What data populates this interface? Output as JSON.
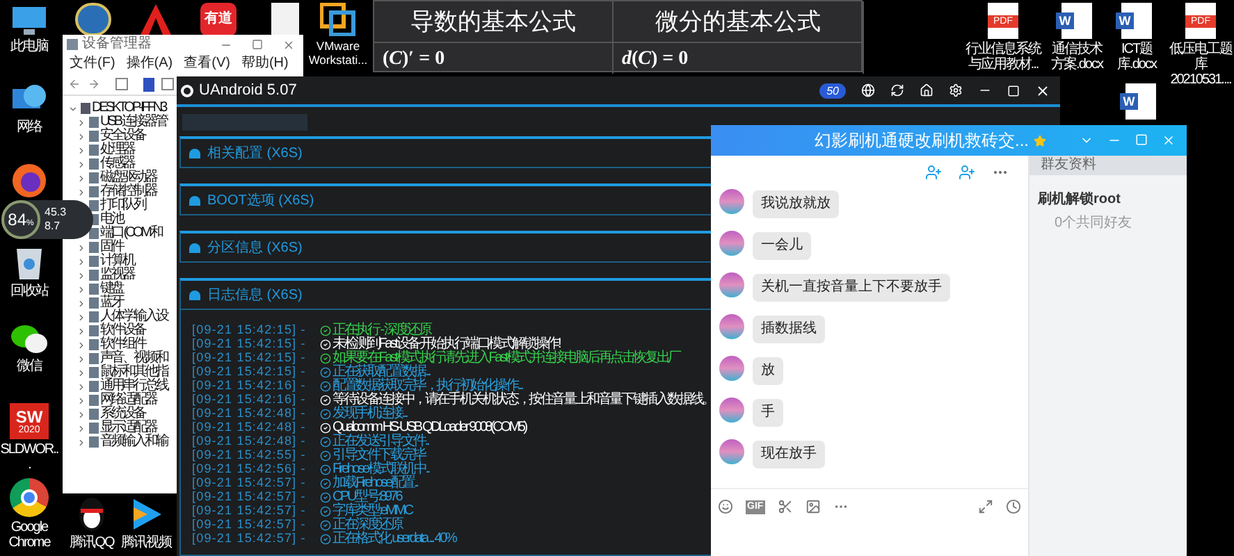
{
  "desktop_left": [
    {
      "kind": "computer",
      "label": "此电脑"
    },
    {
      "kind": "network",
      "label": "网络"
    },
    {
      "kind": "firefox"
    },
    {
      "kind": "recycle",
      "label": "回收站"
    },
    {
      "kind": "wechat",
      "label": "微信"
    },
    {
      "kind": "solidworks",
      "label": "SLDWOR...",
      "logo": "SW",
      "logo_sub": "2020"
    },
    {
      "kind": "chrome",
      "label": "Google Chrome"
    }
  ],
  "net_widget": {
    "percent": "84",
    "unit": "%",
    "upload": "45.3",
    "download": "8.7"
  },
  "desktop_top": [
    {
      "kind": "badge"
    },
    {
      "kind": "acrobat"
    },
    {
      "kind": "youdao",
      "logo": "有道"
    },
    {
      "kind": "file"
    },
    {
      "kind": "vmware",
      "label": "VMware Workstati..."
    }
  ],
  "desktop_bottom": [
    {
      "kind": "qq",
      "label": "腾讯QQ"
    },
    {
      "kind": "video",
      "label": "腾讯视频"
    }
  ],
  "desktop_right": [
    {
      "kind": "pdf",
      "logo": "PDF",
      "label": "行业信息系统与应用教材..."
    },
    {
      "kind": "word",
      "logo": "W",
      "label": "通信技术方案.docx"
    },
    {
      "kind": "word",
      "logo": "W",
      "label": "ICT题库.docx"
    },
    {
      "kind": "pdf",
      "logo": "PDF",
      "label": "低压电工题库20210531...."
    },
    {
      "kind": "word",
      "logo": "W"
    }
  ],
  "formula_slide": {
    "headers": [
      "导数的基本公式",
      "微分的基本公式"
    ],
    "formulas": [
      "(*C*)′ = 0",
      "*d*(*C*) = 0"
    ]
  },
  "device_manager": {
    "title": "设备管理器",
    "menu": [
      "文件(F)",
      "操作(A)",
      "查看(V)",
      "帮助(H)"
    ],
    "tree": [
      {
        "label": "DESKTOP-IFFN3",
        "expanded": true,
        "children": [
          {
            "label": "USB 连接器管",
            "expanded": false
          },
          {
            "label": "安全设备",
            "expanded": false
          },
          {
            "label": "处理器",
            "expanded": false
          },
          {
            "label": "传感器",
            "expanded": false
          },
          {
            "label": "磁盘驱动器",
            "expanded": false
          },
          {
            "label": "存储控制器",
            "expanded": false
          },
          {
            "label": "打印队列",
            "expanded": false
          },
          {
            "label": "电池",
            "expanded": false
          },
          {
            "label": "端口 (COM 和",
            "expanded": false
          },
          {
            "label": "固件",
            "expanded": false
          },
          {
            "label": "计算机",
            "expanded": false
          },
          {
            "label": "监视器",
            "expanded": false
          },
          {
            "label": "键盘",
            "expanded": false
          },
          {
            "label": "蓝牙",
            "expanded": false
          },
          {
            "label": "人体学输入设",
            "expanded": false
          },
          {
            "label": "软件设备",
            "expanded": false
          },
          {
            "label": "软件组件",
            "expanded": false
          },
          {
            "label": "声音、视频和",
            "expanded": false
          },
          {
            "label": "鼠标和其他指",
            "expanded": false
          },
          {
            "label": "通用串行总线",
            "expanded": false
          },
          {
            "label": "网络适配器",
            "expanded": false
          },
          {
            "label": "系统设备",
            "expanded": false
          },
          {
            "label": "显示适配器",
            "expanded": false
          },
          {
            "label": "音频输入和输",
            "expanded": false
          }
        ]
      }
    ]
  },
  "uandroid": {
    "title": "UAndroid 5.07",
    "badge": "50",
    "sections": [
      {
        "label": "相关配置 (X6S)",
        "expanded": false
      },
      {
        "label": "BOOT选项 (X6S)",
        "expanded": false
      },
      {
        "label": "分区信息 (X6S)",
        "expanded": false
      },
      {
        "label": "日志信息 (X6S)",
        "expanded": true
      }
    ],
    "log": [
      {
        "time": "[09-21 15:42:15] -",
        "kind": "success",
        "text": "正在执行 - 深度还原"
      },
      {
        "time": "[09-21 15:42:15] -",
        "kind": "notice",
        "text": "未检测到Fast设备开始执行端口模式解锁操作!"
      },
      {
        "time": "[09-21 15:42:15] -",
        "kind": "success",
        "text": "如果要在Fast模式执行请先进入Fast模式并连接电脑后再点击恢复出厂"
      },
      {
        "time": "[09-21 15:42:15] -",
        "kind": "info",
        "text": "正在获取配置数据..."
      },
      {
        "time": "[09-21 15:42:16] -",
        "kind": "info",
        "text": "配置数据获取完毕，执行初始化操作..."
      },
      {
        "time": "[09-21 15:42:16] -",
        "kind": "notice",
        "text": "等待设备连接中，请在手机关机状态，按住音量上和音量下键插入数据线。"
      },
      {
        "time": "[09-21 15:42:48] -",
        "kind": "info",
        "text": "发现手机连接..."
      },
      {
        "time": "[09-21 15:42:48] -",
        "kind": "notice",
        "text": "Qualcomm HS-USB QDLoader 9008(COM5)"
      },
      {
        "time": "[09-21 15:42:48] -",
        "kind": "info",
        "text": "正在发送引导文件.."
      },
      {
        "time": "[09-21 15:42:55] -",
        "kind": "info",
        "text": "引导文件下载完毕"
      },
      {
        "time": "[09-21 15:42:56] -",
        "kind": "info",
        "text": "Firehose模式联机中.."
      },
      {
        "time": "[09-21 15:42:57] -",
        "kind": "info",
        "text": "加载Firehose配置.."
      },
      {
        "time": "[09-21 15:42:57] -",
        "kind": "info",
        "text": "CPU型号:8976"
      },
      {
        "time": "[09-21 15:42:57] -",
        "kind": "info",
        "text": "字库类型:eMMC"
      },
      {
        "time": "[09-21 15:42:57] -",
        "kind": "info",
        "text": "正在深度还原"
      },
      {
        "time": "[09-21 15:42:57] -",
        "kind": "info",
        "text": "正在格式化 userdata ... 40%"
      }
    ]
  },
  "qq_chat": {
    "title": "幻影刷机通硬改刷机救砖交...",
    "messages": [
      "我说放就放",
      "一会儿",
      "关机一直按音量上下不要放手",
      "插数据线",
      "放",
      "手",
      "现在放手"
    ],
    "gif": "GIF",
    "side_header": "群友资料",
    "member_name": "刷机解锁root",
    "member_note": "0个共同好友"
  }
}
